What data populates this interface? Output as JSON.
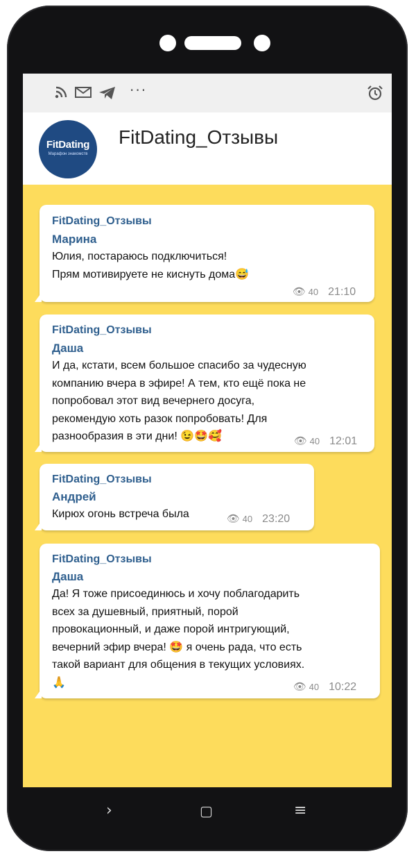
{
  "status_bar": {
    "icons": [
      "rss-icon",
      "mail-icon",
      "telegram-icon",
      "more-icon",
      "alarm-icon"
    ],
    "more_label": "···"
  },
  "channel": {
    "title": "FitDating_Отзывы",
    "avatar_logo": "FitDating",
    "avatar_sub": "Марафон знакомств"
  },
  "messages": [
    {
      "sender": "FitDating_Отзывы",
      "author": "Марина",
      "text": "Юлия, постараюсь подключиться!\nПрям мотивируете не киснуть дома😅",
      "views": "40",
      "time": "21:10"
    },
    {
      "sender": "FitDating_Отзывы",
      "author": "Даша",
      "text": "И да, кстати, всем большое спасибо за чудесную\nкомпанию вчера в эфире! А тем, кто ещё пока не\nпопробовал этот вид вечернего досуга,\nрекомендую хоть разок попробовать! Для\nразнообразия в эти дни! 😉🤩🥰",
      "views": "40",
      "time": "12:01"
    },
    {
      "sender": "FitDating_Отзывы",
      "author": "Андрей",
      "text": "Кирюх огонь встреча была",
      "views": "40",
      "time": "23:20"
    },
    {
      "sender": "FitDating_Отзывы",
      "author": "Даша",
      "text": "Да! Я тоже присоединюсь и хочу поблагодарить\nвсех за душевный, приятный, порой\nпровокационный, и даже порой интригующий,\nвечерний эфир вчера! 🤩 я очень рада, что есть\nтакой вариант для общения в текущих условиях.\n🙏",
      "views": "40",
      "time": "10:22"
    }
  ],
  "nav": {
    "back": "›",
    "home": "▢",
    "menu": "≡"
  },
  "colors": {
    "chat_background": "#fddc5c",
    "name_color": "#2f5f8e",
    "phone_frame": "#121214"
  }
}
